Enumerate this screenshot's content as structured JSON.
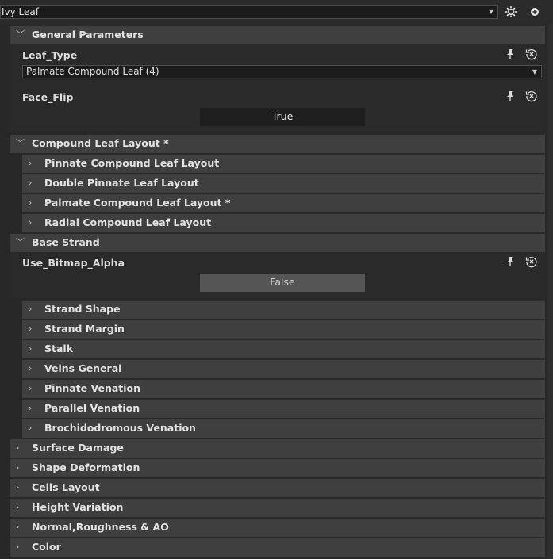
{
  "preset": {
    "value": "Ivy Leaf"
  },
  "groups": {
    "general": "General Parameters",
    "compound": "Compound Leaf Layout *",
    "base_strand": "Base Strand"
  },
  "params": {
    "leaf_type": {
      "label": "Leaf_Type",
      "value": "Palmate Compound Leaf  (4)"
    },
    "face_flip": {
      "label": "Face_Flip",
      "value": "True"
    },
    "use_bitmap_alpha": {
      "label": "Use_Bitmap_Alpha",
      "value": "False"
    }
  },
  "compound_items": [
    "Pinnate Compound Leaf Layout",
    "Double Pinnate Leaf Layout",
    "Palmate Compound Leaf Layout *",
    "Radial Compound Leaf Layout"
  ],
  "base_strand_items": [
    "Strand Shape",
    "Strand Margin",
    "Stalk",
    "Veins General",
    "Pinnate Venation",
    "Parallel Venation",
    "Brochidodromous Venation"
  ],
  "top_sections": [
    "Surface Damage",
    "Shape Deformation",
    "Cells Layout",
    "Height Variation",
    "Normal,Roughness & AO",
    "Color"
  ],
  "icons": {
    "expanded": "chevron-down-icon",
    "collapsed": "chevron-right-icon",
    "pin": "pin-icon",
    "reset": "reset-icon",
    "settings": "gear-icon",
    "add": "plus-icon"
  }
}
